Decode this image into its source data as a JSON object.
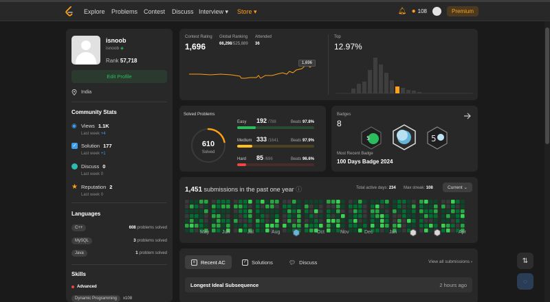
{
  "nav": {
    "items": [
      "Explore",
      "Problems",
      "Contest",
      "Discuss",
      "Interview",
      "Store"
    ],
    "streak": "108",
    "premium": "Premium"
  },
  "profile": {
    "name": "isnoob",
    "handle": "isnoob",
    "rank_label": "Rank",
    "rank": "57,718",
    "edit": "Edit Profile",
    "location": "India"
  },
  "community": {
    "title": "Community Stats",
    "last_week_label": "Last week",
    "items": [
      {
        "label": "Views",
        "value": "1.1K",
        "delta": "+4"
      },
      {
        "label": "Solution",
        "value": "177",
        "delta": "+1"
      },
      {
        "label": "Discuss",
        "value": "0",
        "delta": "0"
      },
      {
        "label": "Reputation",
        "value": "2",
        "delta": "0"
      }
    ]
  },
  "languages": {
    "title": "Languages",
    "items": [
      {
        "name": "C++",
        "count": "608",
        "suffix": "problems solved"
      },
      {
        "name": "MySQL",
        "count": "3",
        "suffix": "problems solved"
      },
      {
        "name": "Java",
        "count": "1",
        "suffix": "problem solved"
      }
    ]
  },
  "skills": {
    "title": "Skills",
    "level": "Advanced",
    "first_skill": "Dynamic Programming",
    "first_count": "x108"
  },
  "contest": {
    "rating_label": "Contest Rating",
    "rating": "1,696",
    "global_label": "Global Ranking",
    "global_rank": "66,298",
    "global_total": "/525,889",
    "attended_label": "Attended",
    "attended": "36",
    "top_label": "Top",
    "top_value": "12.97%",
    "tooltip": "1,696"
  },
  "solved": {
    "title": "Solved Problems",
    "total": "610",
    "total_label": "Solved",
    "beats_label": "Beats",
    "difficulties": [
      {
        "name": "Easy",
        "solved": "192",
        "total": "/788",
        "beats": "97.8%",
        "fill": 0.24,
        "color": "#2cbb5d",
        "track": "#2a4a33"
      },
      {
        "name": "Medium",
        "solved": "333",
        "total": "/1641",
        "beats": "97.9%",
        "fill": 0.2,
        "color": "#ffc01e",
        "track": "#4a4221"
      },
      {
        "name": "Hard",
        "solved": "85",
        "total": "/696",
        "beats": "96.6%",
        "fill": 0.12,
        "color": "#ef4743",
        "track": "#4a2a2a"
      }
    ]
  },
  "badges": {
    "title": "Badges",
    "count": "8",
    "recent_label": "Most Recent Badge",
    "recent": "100 Days Badge 2024"
  },
  "submissions": {
    "count": "1,451",
    "label": "submissions in the past one year",
    "active_label": "Total active days:",
    "active": "234",
    "streak_label": "Max streak:",
    "streak": "108",
    "current": "Current",
    "months": [
      "May",
      "Jun",
      "Jul",
      "Aug",
      "Oct",
      "Nov",
      "Dec",
      "Jan",
      "Apr"
    ]
  },
  "recent": {
    "tabs": [
      "Recent AC",
      "Solutions",
      "Discuss"
    ],
    "view_all": "View all submissions",
    "item_title": "Longest Ideal Subsequence",
    "item_time": "2 hours ago"
  },
  "colors": {
    "accent": "#ffa116",
    "green": "#2cbb5d",
    "card": "#282828"
  }
}
